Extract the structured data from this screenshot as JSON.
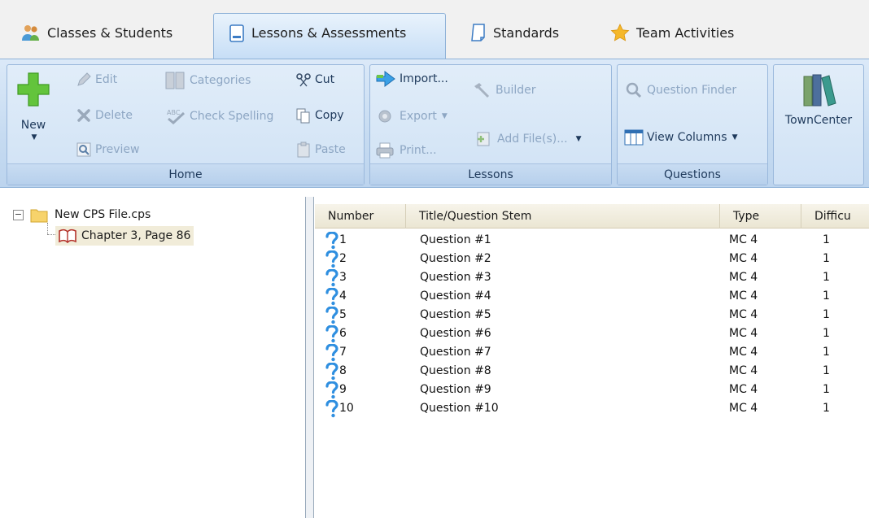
{
  "tabs": [
    {
      "label": "Classes & Students",
      "icon": "people-icon",
      "active": false
    },
    {
      "label": "Lessons & Assessments",
      "icon": "document-icon",
      "active": true
    },
    {
      "label": "Standards",
      "icon": "page-icon",
      "active": false
    },
    {
      "label": "Team Activities",
      "icon": "star-icon",
      "active": false
    }
  ],
  "ribbon": {
    "home": {
      "label": "Home",
      "new_label": "New",
      "edit_label": "Edit",
      "delete_label": "Delete",
      "preview_label": "Preview",
      "categories_label": "Categories",
      "check_spelling_label": "Check Spelling",
      "cut_label": "Cut",
      "copy_label": "Copy",
      "paste_label": "Paste"
    },
    "lessons": {
      "label": "Lessons",
      "import_label": "Import...",
      "export_label": "Export",
      "print_label": "Print...",
      "builder_label": "Builder",
      "add_files_label": "Add File(s)..."
    },
    "questions": {
      "label": "Questions",
      "question_finder_label": "Question Finder",
      "view_columns_label": "View Columns"
    },
    "towncenter": {
      "label": "TownCenter"
    }
  },
  "tree": {
    "root_expander": "−",
    "root_label": "New CPS File.cps",
    "child_label": "Chapter 3, Page 86"
  },
  "grid": {
    "columns": [
      "Number",
      "Title/Question Stem",
      "Type",
      "Difficu"
    ],
    "rows": [
      {
        "number": "1",
        "title": "Question #1",
        "type": "MC 4",
        "difficulty": "1"
      },
      {
        "number": "2",
        "title": "Question #2",
        "type": "MC 4",
        "difficulty": "1"
      },
      {
        "number": "3",
        "title": "Question #3",
        "type": "MC 4",
        "difficulty": "1"
      },
      {
        "number": "4",
        "title": "Question #4",
        "type": "MC 4",
        "difficulty": "1"
      },
      {
        "number": "5",
        "title": "Question #5",
        "type": "MC 4",
        "difficulty": "1"
      },
      {
        "number": "6",
        "title": "Question #6",
        "type": "MC 4",
        "difficulty": "1"
      },
      {
        "number": "7",
        "title": "Question #7",
        "type": "MC 4",
        "difficulty": "1"
      },
      {
        "number": "8",
        "title": "Question #8",
        "type": "MC 4",
        "difficulty": "1"
      },
      {
        "number": "9",
        "title": "Question #9",
        "type": "MC 4",
        "difficulty": "1"
      },
      {
        "number": "10",
        "title": "Question #10",
        "type": "MC 4",
        "difficulty": "1"
      }
    ]
  },
  "colors": {
    "ribbon_bg": "#c6dbf1",
    "ribbon_text": "#1e395b",
    "disabled_text": "#8da6c3",
    "selection_bg": "#f1ecd9",
    "question_icon": "#2f8fe0",
    "new_plus": "#5fc43a"
  }
}
